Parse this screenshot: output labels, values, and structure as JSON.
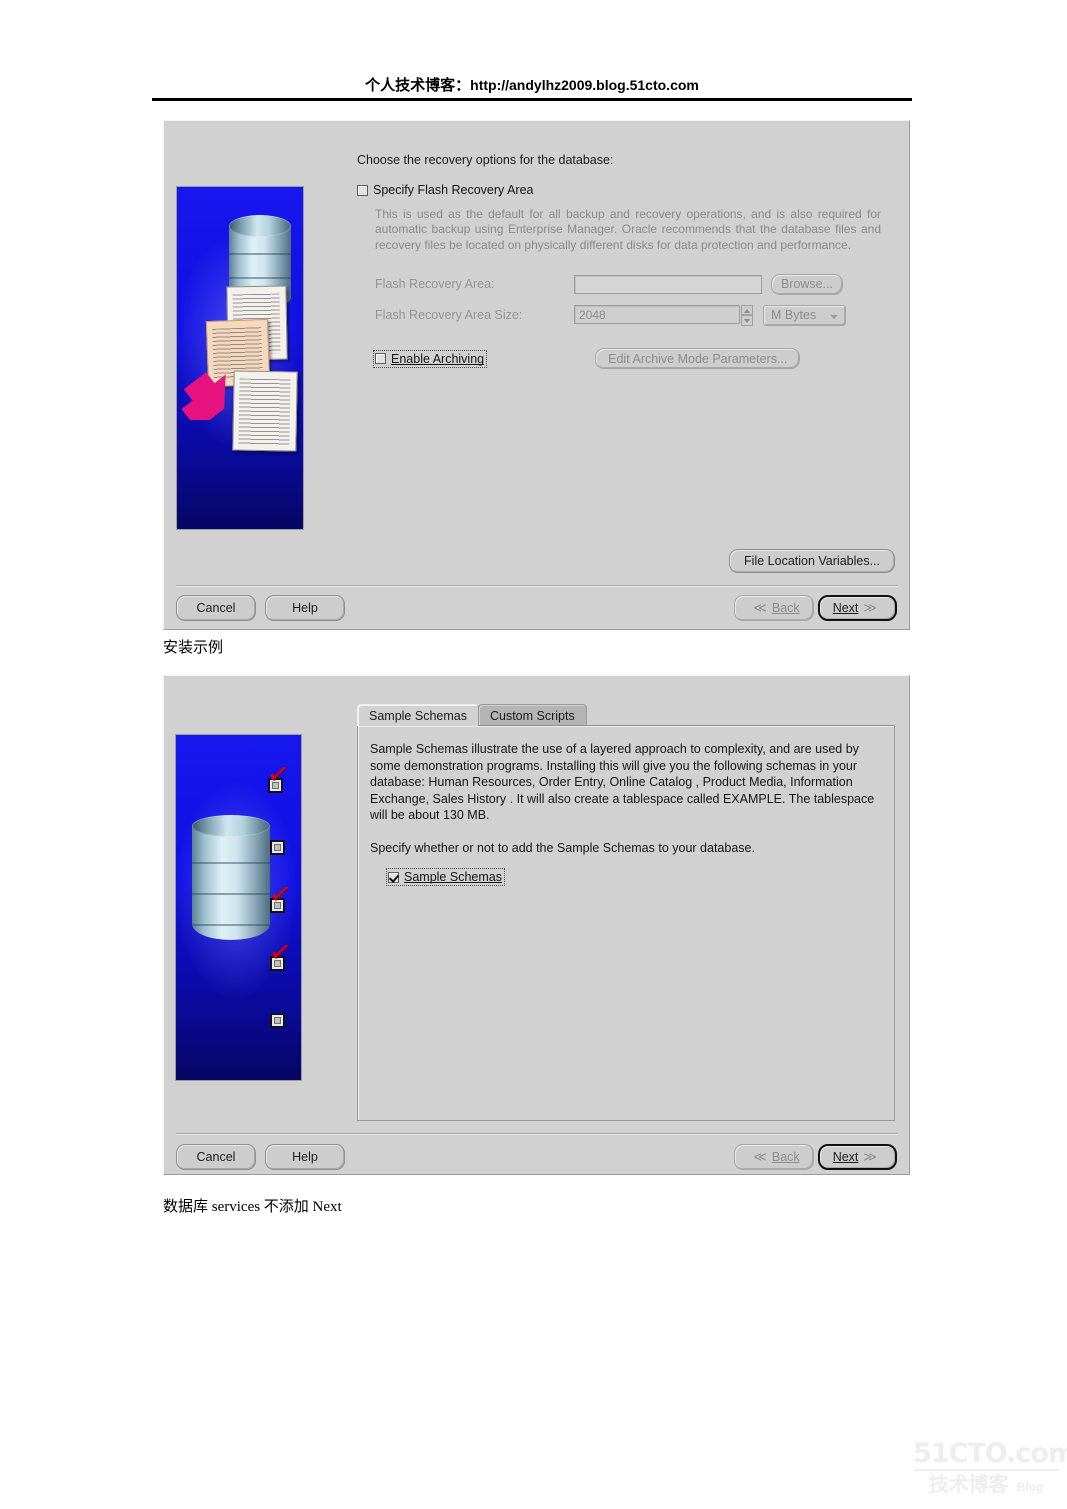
{
  "page": {
    "header_title": "个人技术博客：",
    "header_url": "http://andylhz2009.blog.51cto.com",
    "caption_install": "安装示例",
    "caption_services": "数据库 services 不添加 Next"
  },
  "watermark": {
    "top": "51CTO.com",
    "cn": "技术博客",
    "blog": "Blog"
  },
  "dialog_recovery": {
    "prompt": "Choose the recovery options for the database:",
    "specify_flash_recovery_area": {
      "label": "Specify Flash Recovery Area",
      "checked": false
    },
    "help_text": "This is used as the default for all backup and recovery operations, and is also required for automatic backup using Enterprise Manager. Oracle recommends that the database files and recovery files be located on physically different disks for data protection and performance.",
    "fields": {
      "area_label": "Flash Recovery Area:",
      "area_value": "",
      "area_placeholder": "",
      "browse_label": "Browse...",
      "size_label": "Flash Recovery Area Size:",
      "size_value": "2048",
      "units_value": "M Bytes"
    },
    "enable_archiving": {
      "label": "Enable Archiving",
      "checked": false
    },
    "edit_archive_label": "Edit Archive Mode Parameters...",
    "file_location_label": "File Location Variables...",
    "buttons": {
      "cancel": "Cancel",
      "help": "Help",
      "back": "Back",
      "next": "Next",
      "back_icon": "chevron-double-left-icon",
      "next_icon": "chevron-double-right-icon"
    },
    "illustration": {
      "name": "database-documents-arrow-illustration",
      "background_color": "#0b0bdd",
      "arrow_color": "#e6127f"
    }
  },
  "dialog_schemas": {
    "tabs": [
      {
        "label": "Sample Schemas",
        "active": true
      },
      {
        "label": "Custom Scripts",
        "active": false
      }
    ],
    "paragraph_1": "Sample Schemas illustrate the use of a layered approach to complexity, and are used by some demonstration programs. Installing this will give you the following schemas in your database: Human Resources, Order Entry, Online Catalog , Product Media, Information Exchange, Sales History . It will also create a tablespace called EXAMPLE. The tablespace will be about 130 MB.",
    "paragraph_2": "Specify whether or not to add the Sample Schemas to your database.",
    "sample_schemas_checkbox": {
      "label": "Sample Schemas",
      "checked": true
    },
    "buttons": {
      "cancel": "Cancel",
      "help": "Help",
      "back": "Back",
      "next": "Next",
      "back_icon": "chevron-double-left-icon",
      "next_icon": "chevron-double-right-icon"
    },
    "illustration": {
      "name": "database-checklist-illustration",
      "background_color": "#0b0bdd",
      "check_color": "#e00000",
      "checks": [
        true,
        false,
        true,
        true,
        false
      ]
    }
  }
}
